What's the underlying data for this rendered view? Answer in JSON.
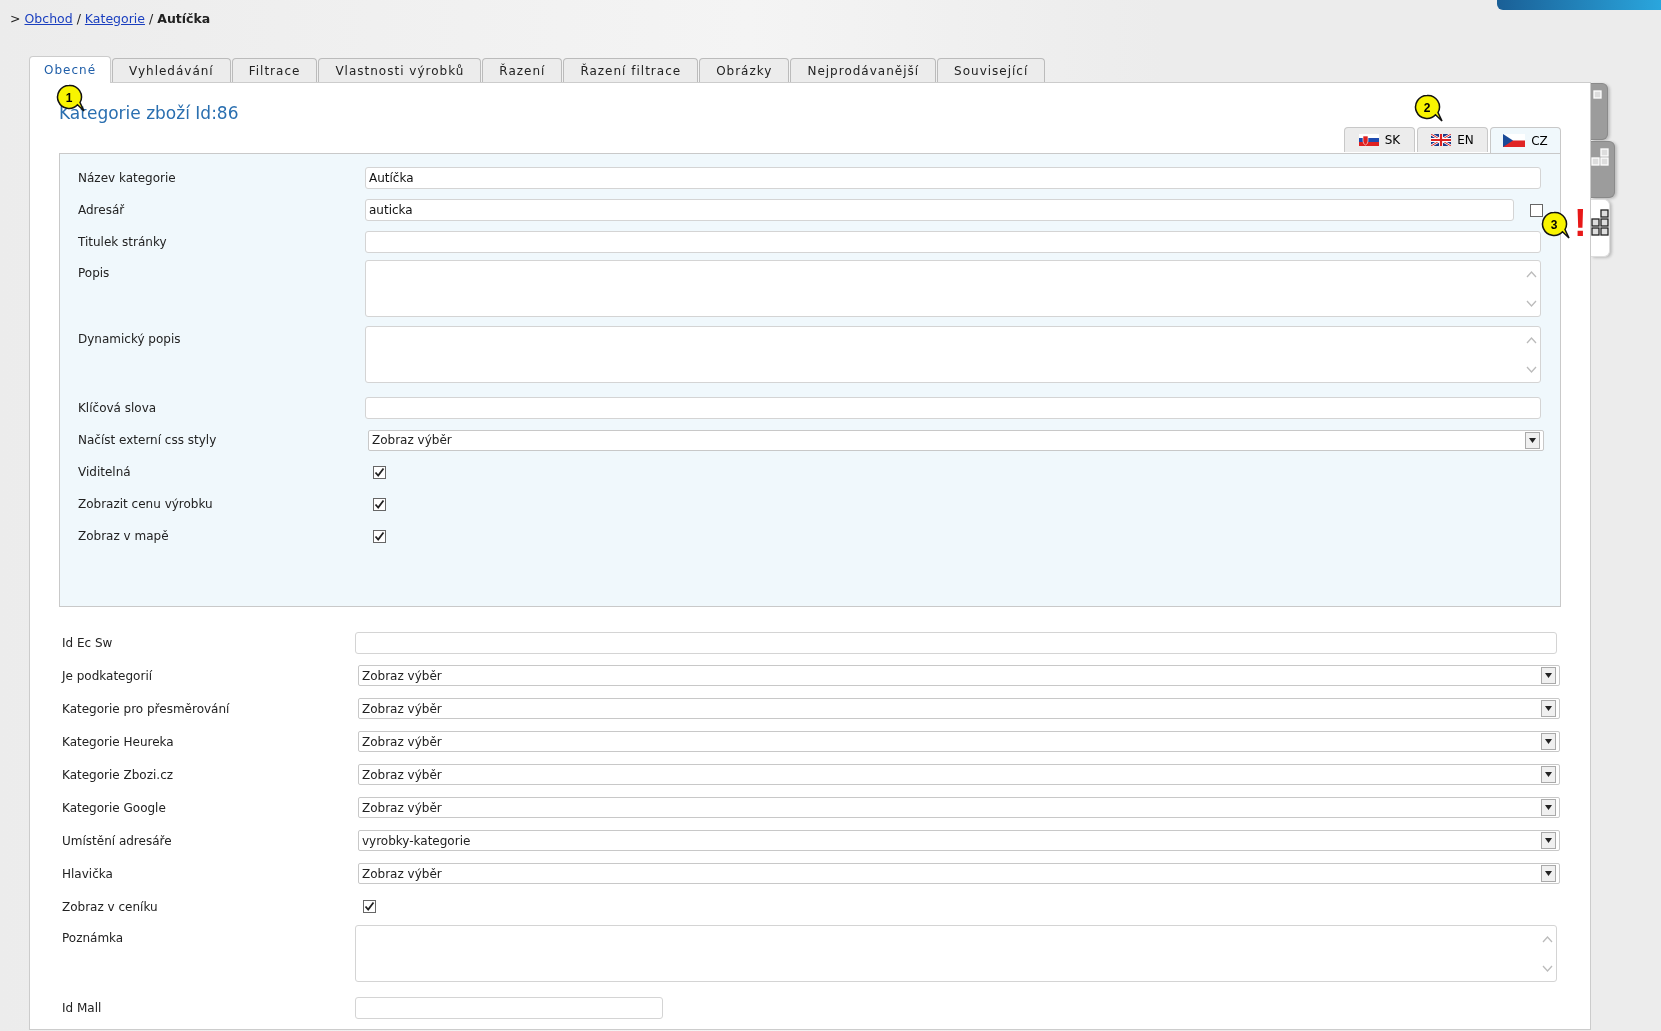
{
  "breadcrumb": [
    {
      "kind": "prefix",
      "text": ">"
    },
    {
      "kind": "link",
      "text": "Obchod"
    },
    {
      "kind": "separator",
      "text": "/"
    },
    {
      "kind": "link",
      "text": "Kategorie"
    },
    {
      "kind": "separator",
      "text": "/"
    },
    {
      "kind": "current",
      "text": "Autíčka"
    }
  ],
  "tabs": [
    {
      "label": "Obecné",
      "selected": true,
      "callout": "1"
    },
    {
      "label": "Vyhledávání",
      "selected": false
    },
    {
      "label": "Filtrace",
      "selected": false
    },
    {
      "label": "Vlastnosti výrobků",
      "selected": false
    },
    {
      "label": "Řazení",
      "selected": false
    },
    {
      "label": "Řazení filtrace",
      "selected": false
    },
    {
      "label": "Obrázky",
      "selected": false
    },
    {
      "label": "Nejprodávanější",
      "selected": false
    },
    {
      "label": "Související",
      "selected": false
    }
  ],
  "heading": "Kategorie zboží Id:86",
  "language_tabs": [
    {
      "label": "SK",
      "selected": false
    },
    {
      "label": "EN",
      "selected": false,
      "callout": "2"
    },
    {
      "label": "CZ",
      "selected": true
    }
  ],
  "panel_fields": [
    {
      "label": "Název kategorie",
      "kind": "text",
      "value": "Autíčka"
    },
    {
      "label": "Adresář",
      "kind": "text",
      "value": "auticka",
      "extra_checkbox": {
        "checked": false
      }
    },
    {
      "label": "Titulek stránky",
      "kind": "text"
    },
    {
      "label": "Popis",
      "kind": "textarea"
    },
    {
      "label": "Dynamický popis",
      "kind": "textarea"
    },
    {
      "label": "Klíčová slova",
      "kind": "text"
    },
    {
      "label": "Načíst externí css styly",
      "kind": "select",
      "value": "Zobraz výběr"
    },
    {
      "label": "Viditelná",
      "kind": "checkbox",
      "checked": true
    },
    {
      "label": "Zobrazit cenu výrobku",
      "kind": "checkbox",
      "checked": true
    },
    {
      "label": "Zobraz v mapě",
      "kind": "checkbox",
      "checked": true
    }
  ],
  "fields": [
    {
      "label": "Id Ec Sw",
      "kind": "text"
    },
    {
      "label": "Je podkategorií",
      "kind": "select",
      "value": "Zobraz výběr"
    },
    {
      "label": "Kategorie pro přesměrování",
      "kind": "select",
      "value": "Zobraz výběr"
    },
    {
      "label": "Kategorie Heureka",
      "kind": "select",
      "value": "Zobraz výběr"
    },
    {
      "label": "Kategorie Zbozi.cz",
      "kind": "select",
      "value": "Zobraz výběr"
    },
    {
      "label": "Kategorie Google",
      "kind": "select",
      "value": "Zobraz výběr"
    },
    {
      "label": "Umístění adresáře",
      "kind": "select",
      "value": "vyrobky-kategorie"
    },
    {
      "label": "Hlavička",
      "kind": "select",
      "value": "Zobraz výběr"
    },
    {
      "label": "Zobraz v ceníku",
      "kind": "checkbox",
      "checked": true
    },
    {
      "label": "Poznámka",
      "kind": "textarea"
    },
    {
      "label": "Id Mall",
      "kind": "short_text"
    }
  ],
  "side_tabs": [
    {
      "selected": false
    },
    {
      "selected": false
    },
    {
      "selected": true,
      "warning": "!",
      "callout": "3"
    }
  ]
}
